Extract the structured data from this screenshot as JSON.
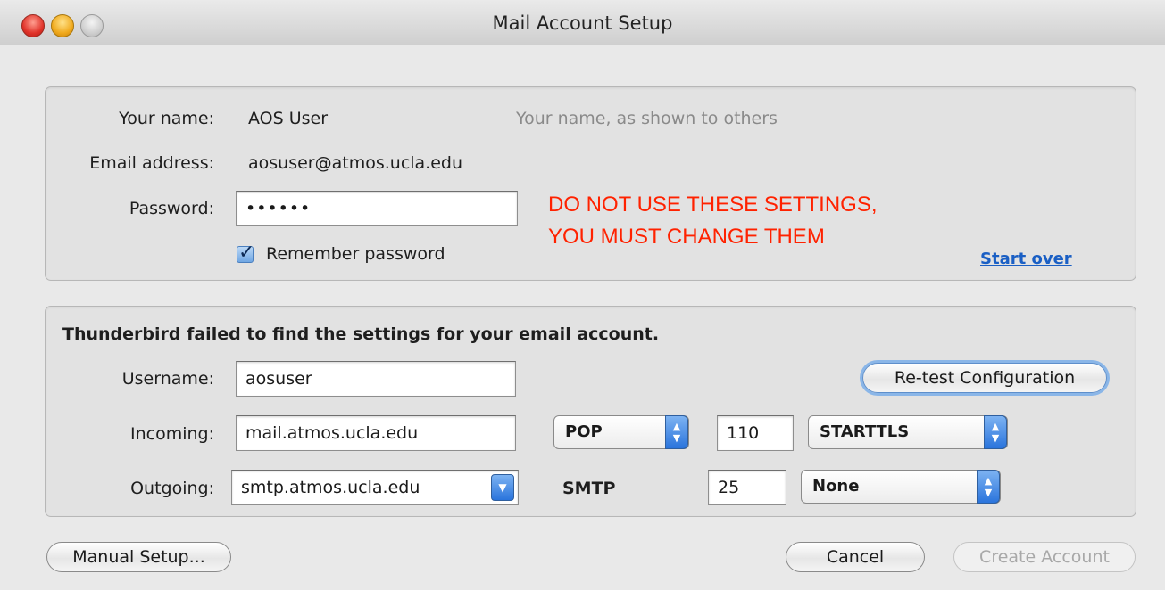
{
  "window": {
    "title": "Mail Account Setup"
  },
  "account": {
    "name_label": "Your name:",
    "name_value": "AOS User",
    "name_hint": "Your name, as shown to others",
    "email_label": "Email address:",
    "email_value": "aosuser@atmos.ucla.edu",
    "password_label": "Password:",
    "password_value": "••••••",
    "remember_label": "Remember password",
    "remember_checked": true,
    "start_over": "Start over"
  },
  "warning": {
    "line1": "DO NOT USE THESE SETTINGS,",
    "line2": "YOU MUST CHANGE THEM",
    "color": "#ff2200"
  },
  "config": {
    "status": "Thunderbird failed to find the settings for your email account.",
    "retest_button": "Re-test Configuration",
    "username_label": "Username:",
    "username_value": "aosuser",
    "incoming_label": "Incoming:",
    "incoming_server": "mail.atmos.ucla.edu",
    "incoming_protocol": "POP",
    "incoming_port": "110",
    "incoming_security": "STARTTLS",
    "outgoing_label": "Outgoing:",
    "outgoing_server": "smtp.atmos.ucla.edu",
    "outgoing_protocol": "SMTP",
    "outgoing_port": "25",
    "outgoing_security": "None"
  },
  "footer": {
    "manual_setup": "Manual Setup...",
    "cancel": "Cancel",
    "create_account": "Create Account"
  }
}
